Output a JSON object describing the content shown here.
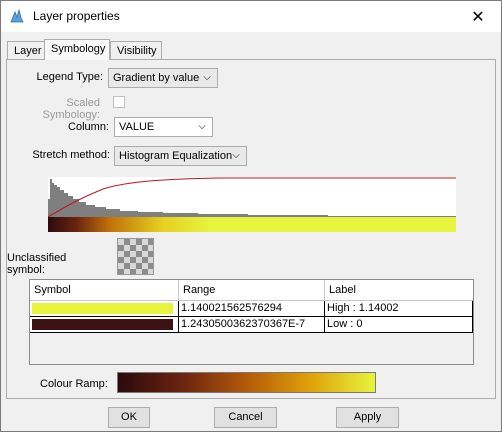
{
  "window": {
    "title": "Layer properties",
    "close_glyph": "✕",
    "icon": "app-icon"
  },
  "tabs": [
    {
      "label": "Layer",
      "active": false
    },
    {
      "label": "Symbology",
      "active": true
    },
    {
      "label": "Visibility",
      "active": false
    }
  ],
  "form": {
    "legend_type_label": "Legend Type:",
    "legend_type_value": "Gradient by value",
    "scaled_symbology_label": "Scaled Symbology:",
    "scaled_symbology_checked": false,
    "column_label": "Column:",
    "column_value": "VALUE",
    "stretch_label": "Stretch method:",
    "stretch_value": "Histogram Equalization"
  },
  "unclassified": {
    "label": "Unclassified symbol:"
  },
  "table": {
    "headers": [
      "Symbol",
      "Range",
      "Label"
    ],
    "rows": [
      {
        "color": "#e6f53c",
        "range": "1.140021562576294",
        "label": "High : 1.14002"
      },
      {
        "color": "#3c1214",
        "range": "1.2430500362370367E-7",
        "label": "Low : 0"
      }
    ]
  },
  "ramp": {
    "label": "Colour Ramp:",
    "colors": [
      "#2b0a0e",
      "#6b2410",
      "#b35a08",
      "#e0a20a",
      "#e6f53c"
    ]
  },
  "buttons": {
    "ok": "OK",
    "cancel": "Cancel",
    "apply": "Apply"
  },
  "colors": {
    "accent": "#0078d7",
    "histogram": "#7f7f7f",
    "curve": "#c0141e"
  }
}
